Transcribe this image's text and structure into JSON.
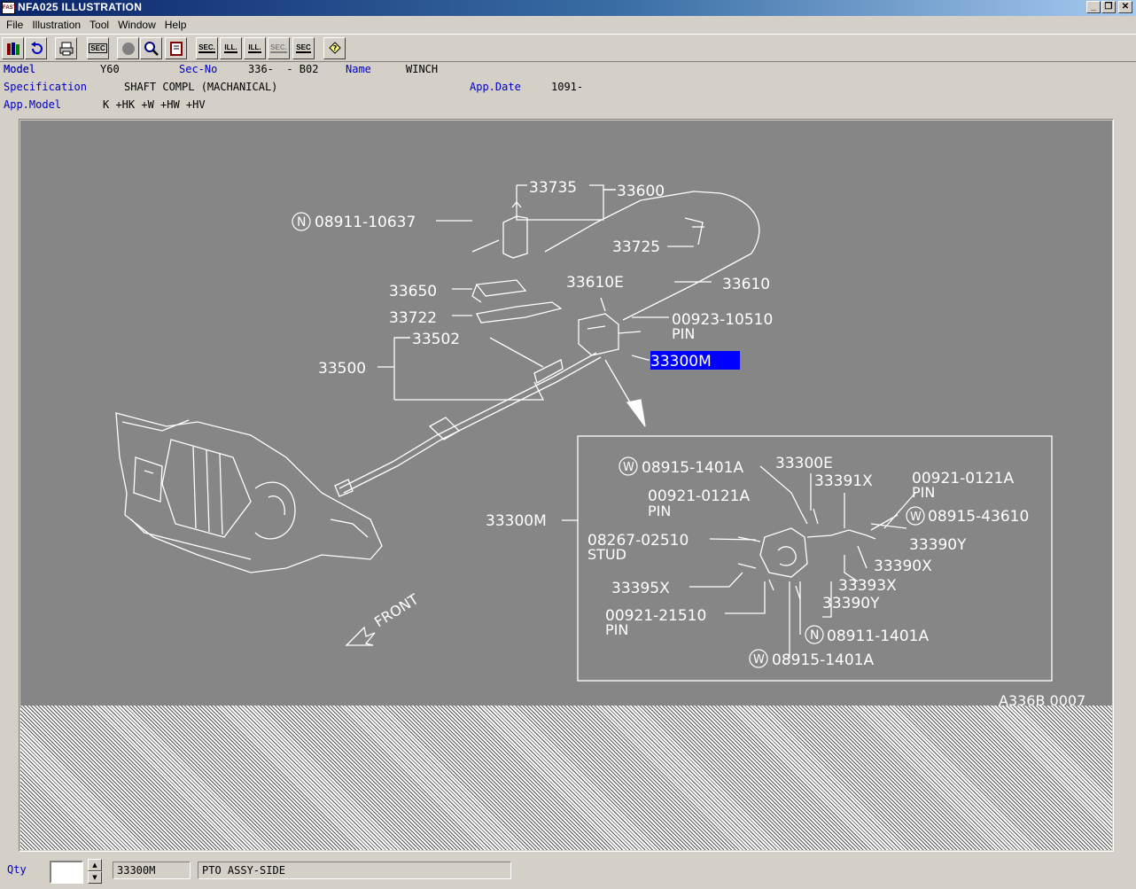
{
  "window": {
    "title": "NFA025  ILLUSTRATION",
    "app_icon_text": "FAST"
  },
  "menu": [
    "File",
    "Illustration",
    "Tool",
    "Window",
    "Help"
  ],
  "toolbar_labels": {
    "sec1": "SEC",
    "sec2": "SEC.",
    "ill1": "ILL.",
    "ill2": "ILL.",
    "sec3": "SEC.",
    "sec4": "SEC"
  },
  "info": {
    "model_label": "Model",
    "model_value": "Y60",
    "secno_label": "Sec-No",
    "secno_value": "336-  - B02",
    "name_label": "Name",
    "name_value": "WINCH",
    "spec_label": "Specification",
    "spec_value": "SHAFT COMPL (MACHANICAL)",
    "appdate_label": "App.Date",
    "appdate_value": "1091-",
    "appmodel_label": "App.Model",
    "appmodel_value": "K +HK +W +HW +HV"
  },
  "drawing": {
    "labels": {
      "p33735": "33735",
      "p33600": "33600",
      "p08911_10637": "08911-10637",
      "p33725": "33725",
      "p33650": "33650",
      "p33610E": "33610E",
      "p33610": "33610",
      "p33722": "33722",
      "p00923_10510": "00923-10510",
      "pin1": "PIN",
      "p33502": "33502",
      "p33500": "33500",
      "p33300M_sel": "33300M",
      "front": "FRONT",
      "d08915_1401A_a": "08915-1401A",
      "d33300E": "33300E",
      "d33391X": "33391X",
      "d00921_0121A_r": "00921-0121A",
      "pin_r": "PIN",
      "d00921_0121A_l": "00921-0121A",
      "pin_l": "PIN",
      "d08915_43610": "08915-43610",
      "d33300M": "33300M",
      "d08267_02510": "08267-02510",
      "stud": "STUD",
      "d33390Y_a": "33390Y",
      "d33390X": "33390X",
      "d33393X": "33393X",
      "d33395X": "33395X",
      "d33390Y_b": "33390Y",
      "d00921_21510": "00921-21510",
      "pin_b": "PIN",
      "d08911_1401A": "08911-1401A",
      "d08915_1401A_b": "08915-1401A",
      "circle_N": "N",
      "circle_W": "W",
      "ref_code": "A336B 0007"
    }
  },
  "status": {
    "qty_label": "Qty",
    "qty_value": "",
    "part_no": "33300M",
    "part_name": "PTO ASSY-SIDE"
  },
  "colors": {
    "drawing_bg": "#868686",
    "selection": "#0000ff",
    "label_blue": "#0000c0"
  }
}
